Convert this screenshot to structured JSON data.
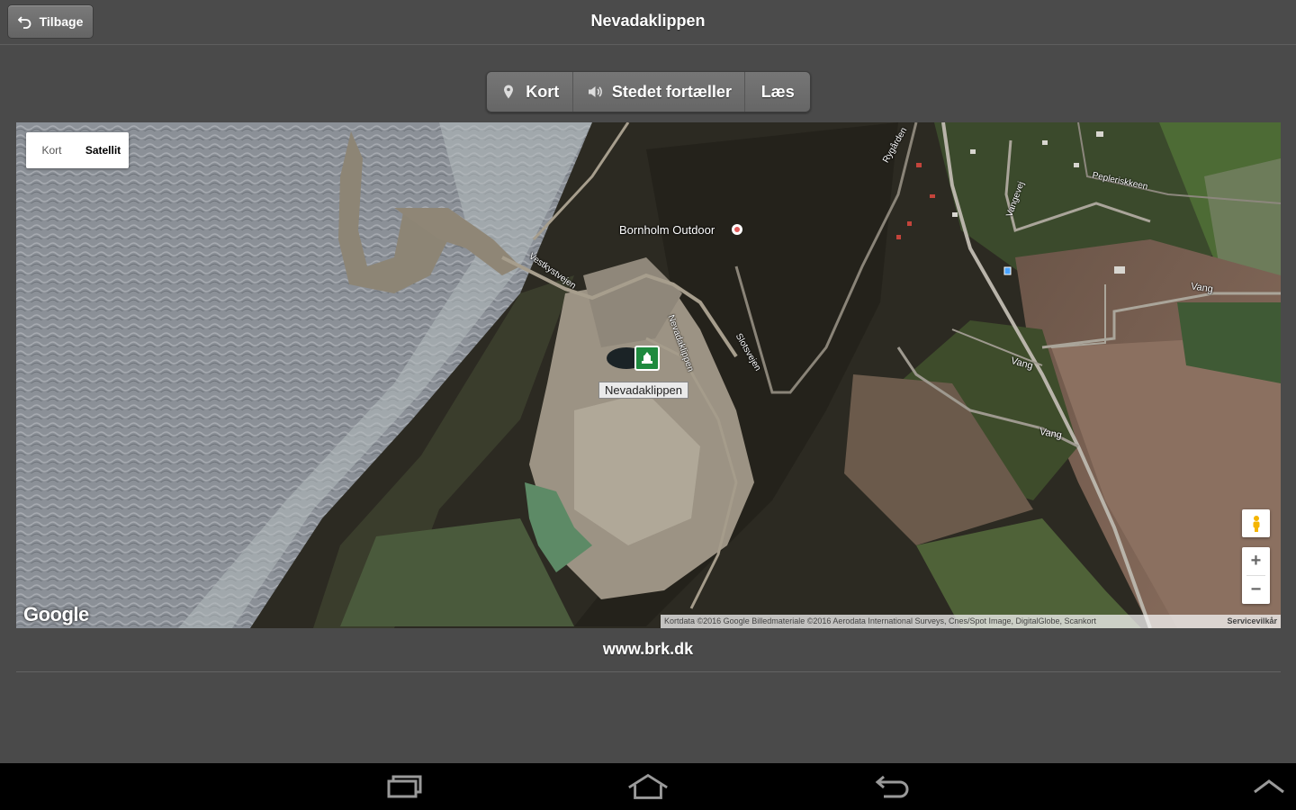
{
  "header": {
    "back_label": "Tilbage",
    "title": "Nevadaklippen"
  },
  "tabs": [
    {
      "label": "Kort",
      "icon": "map-pin-icon"
    },
    {
      "label": "Stedet fortæller",
      "icon": "speaker-icon"
    },
    {
      "label": "Læs"
    }
  ],
  "map": {
    "type_toggle": {
      "map_label": "Kort",
      "satellite_label": "Satellit",
      "active": "Satellit"
    },
    "place_label": "Nevadaklippen",
    "poi_label": "Bornholm Outdoor",
    "road_labels": [
      "Vang",
      "Vang",
      "Vang",
      "Pepleriskkeen",
      "Vestkystvejen",
      "Nevadaklippen",
      "Slotsvejen",
      "Vangevej",
      "Rygården"
    ],
    "google_label": "Google",
    "attribution": "Kortdata ©2016 Google Billedmateriale ©2016 Aerodata International Surveys, Cnes/Spot Image, DigitalGlobe, Scankort",
    "terms_label": "Servicevilkår",
    "zoom_in": "+",
    "zoom_out": "−"
  },
  "footer": {
    "site_link": "www.brk.dk"
  },
  "system_nav": [
    "recent-apps-icon",
    "home-icon",
    "back-icon",
    "chevron-up-icon"
  ]
}
